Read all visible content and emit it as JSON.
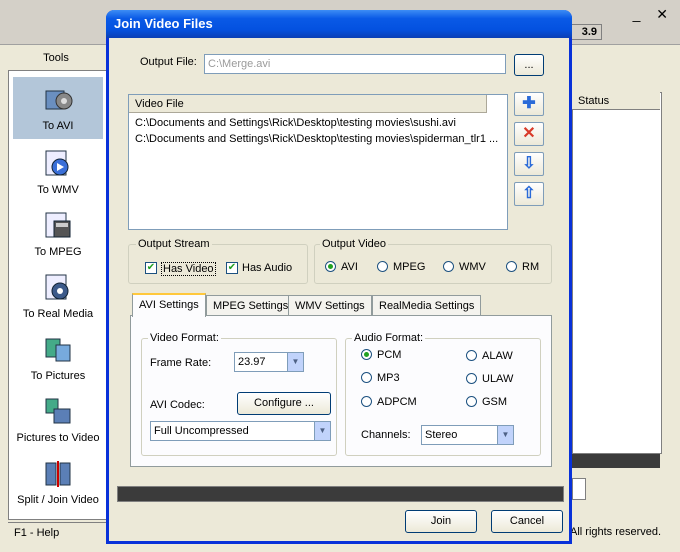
{
  "background": {
    "version": "3.9",
    "top_buttons": "_ ✕",
    "tools_header": "Tools",
    "sidebar": [
      {
        "label": "To AVI",
        "icon": "avi-film-icon",
        "selected": true
      },
      {
        "label": "To WMV",
        "icon": "wmv-icon",
        "selected": false
      },
      {
        "label": "To MPEG",
        "icon": "mpeg-icon",
        "selected": false
      },
      {
        "label": "To Real Media",
        "icon": "real-media-icon",
        "selected": false
      },
      {
        "label": "To Pictures",
        "icon": "pictures-icon",
        "selected": false
      },
      {
        "label": "Pictures to Video",
        "icon": "pictures-to-video-icon",
        "selected": false
      },
      {
        "label": "Split / Join Video",
        "icon": "split-join-icon",
        "selected": false
      }
    ],
    "status_left": "F1 - Help",
    "status_right": "All rights reserved.",
    "status_column": "Status"
  },
  "dialog": {
    "title": "Join Video Files",
    "output_file_label": "Output File:",
    "output_file_value": "C:\\Merge.avi",
    "browse_label": "...",
    "list_header": "Video File",
    "files": [
      "C:\\Documents and Settings\\Rick\\Desktop\\testing movies\\sushi.avi",
      "C:\\Documents and Settings\\Rick\\Desktop\\testing movies\\spiderman_tlr1 ..."
    ],
    "list_buttons": [
      "add-icon",
      "remove-icon",
      "move-down-icon",
      "move-up-icon"
    ],
    "output_stream": {
      "title": "Output Stream",
      "has_video": "Has Video",
      "has_audio": "Has Audio"
    },
    "output_video": {
      "title": "Output Video",
      "options": [
        "AVI",
        "MPEG",
        "WMV",
        "RM"
      ],
      "selected": "AVI"
    },
    "tabs": [
      "AVI Settings",
      "MPEG Settings",
      "WMV Settings",
      "RealMedia Settings"
    ],
    "video_format": {
      "title": "Video Format:",
      "frame_rate_label": "Frame Rate:",
      "frame_rate_value": "23.97",
      "codec_label": "AVI Codec:",
      "configure_label": "Configure ...",
      "codec_value": "Full Uncompressed"
    },
    "audio_format": {
      "title": "Audio Format:",
      "options_left": [
        "PCM",
        "MP3",
        "ADPCM"
      ],
      "options_right": [
        "ALAW",
        "ULAW",
        "GSM"
      ],
      "selected": "PCM",
      "channels_label": "Channels:",
      "channels_value": "Stereo"
    },
    "join_label": "Join",
    "cancel_label": "Cancel"
  }
}
